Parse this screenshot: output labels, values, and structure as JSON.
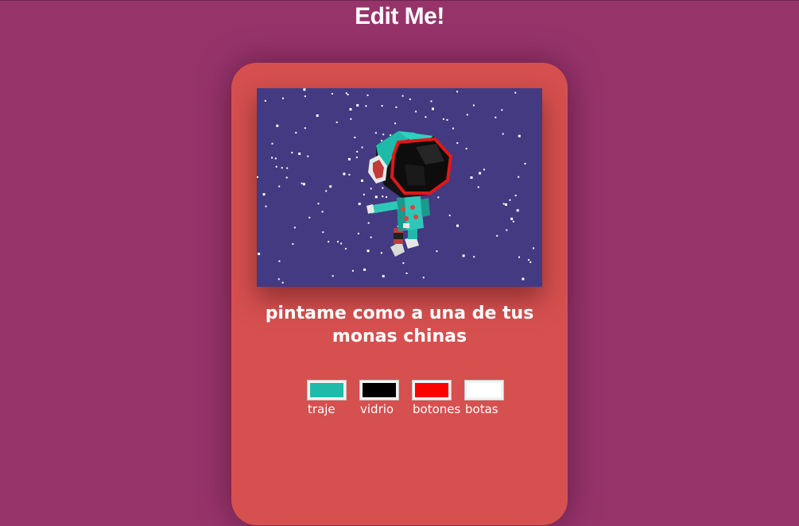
{
  "page": {
    "title": "Edit Me!"
  },
  "card": {
    "caption": "pintame como a una de tus monas chinas"
  },
  "colors": {
    "background": "#96346a",
    "card": "#d5504f",
    "scene": "#433a81"
  },
  "pickers": [
    {
      "label": "traje",
      "value": "#1fbaaa"
    },
    {
      "label": "vidrio",
      "value": "#000000"
    },
    {
      "label": "botones",
      "value": "#ff0000"
    },
    {
      "label": "botas",
      "value": "#ffffff"
    }
  ]
}
